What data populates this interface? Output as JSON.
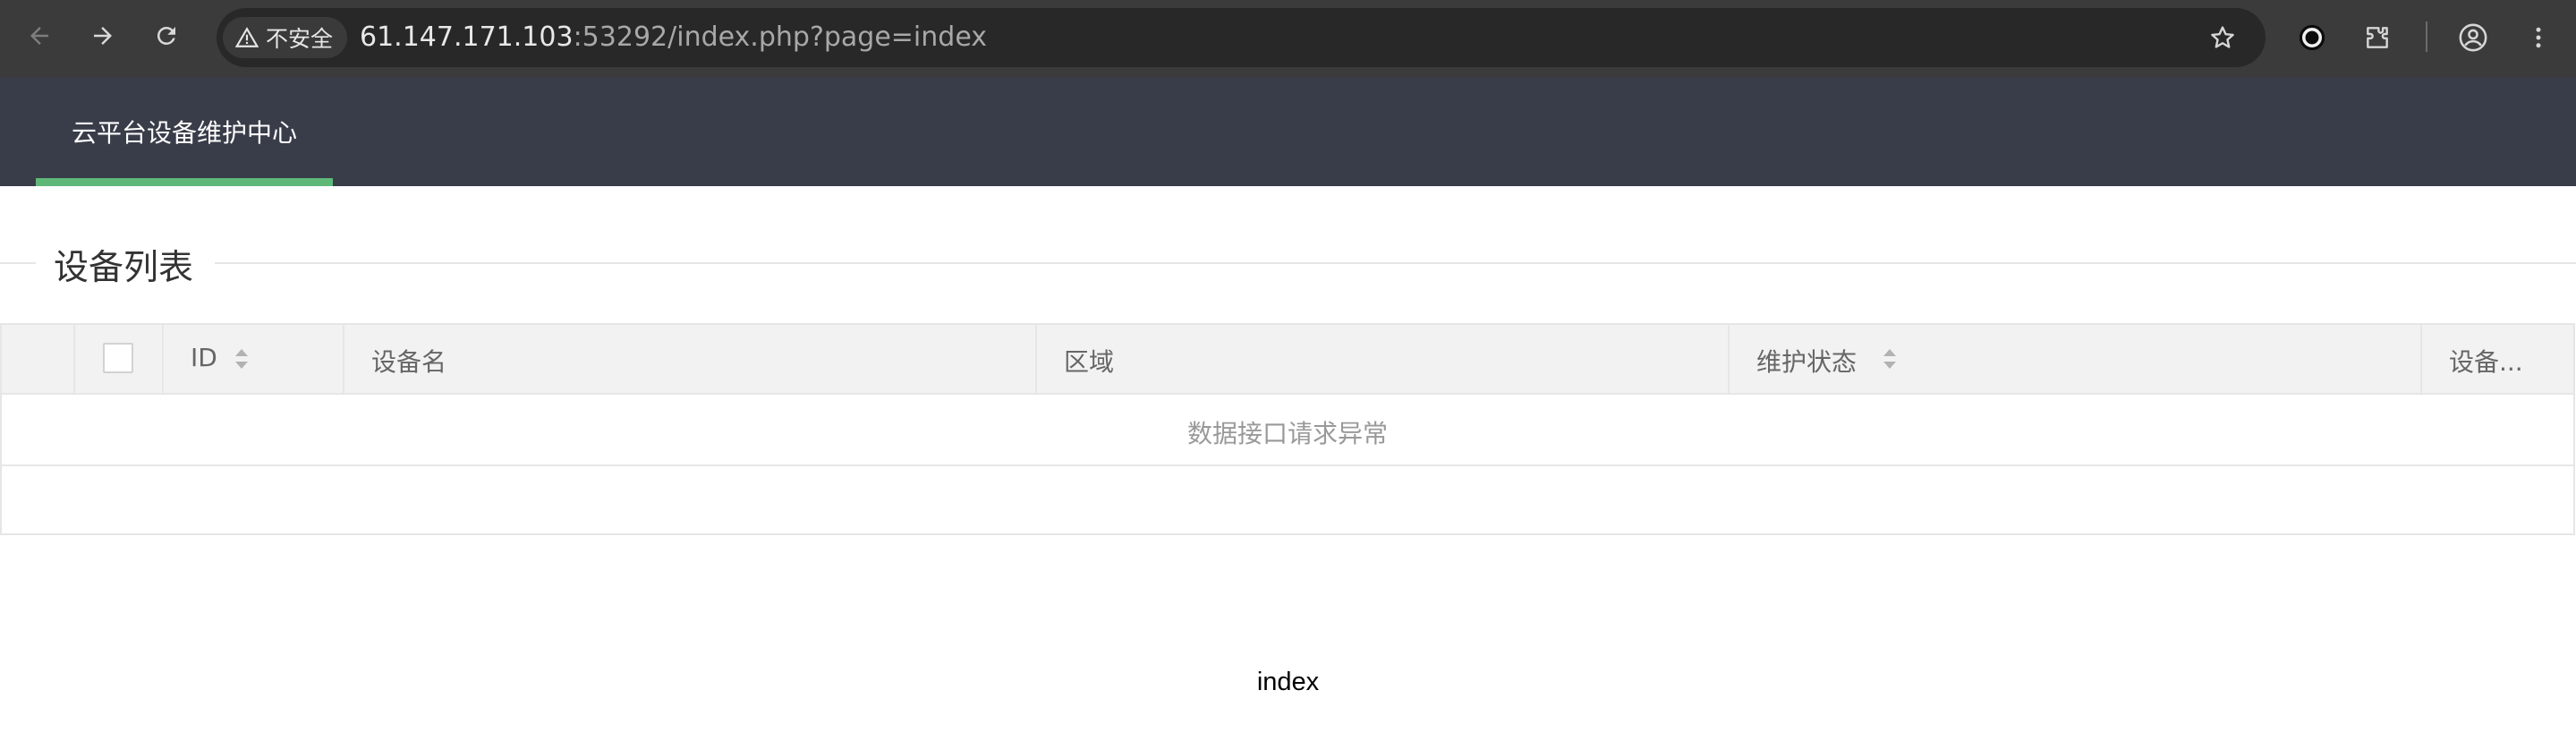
{
  "browser": {
    "security_label": "不安全",
    "url_host": "61.147.171.103",
    "url_rest": ":53292/index.php?page=index"
  },
  "app": {
    "nav_item": "云平台设备维护中心",
    "accent_color": "#5fb878",
    "header_color": "#393d49"
  },
  "section": {
    "title": "设备列表"
  },
  "table": {
    "columns": [
      {
        "label": "ID",
        "sortable": true
      },
      {
        "label": "设备名",
        "sortable": false
      },
      {
        "label": "区域",
        "sortable": false
      },
      {
        "label": "维护状态",
        "sortable": true
      },
      {
        "label": "设备...",
        "sortable": false
      }
    ],
    "empty_message": "数据接口请求异常"
  },
  "footer": {
    "text": "index"
  },
  "icons": [
    "back-arrow-icon",
    "forward-arrow-icon",
    "reload-icon",
    "warning-icon",
    "star-icon",
    "extension-record-icon",
    "puzzle-extension-icon",
    "profile-icon",
    "kebab-menu-icon",
    "sort-icon"
  ]
}
